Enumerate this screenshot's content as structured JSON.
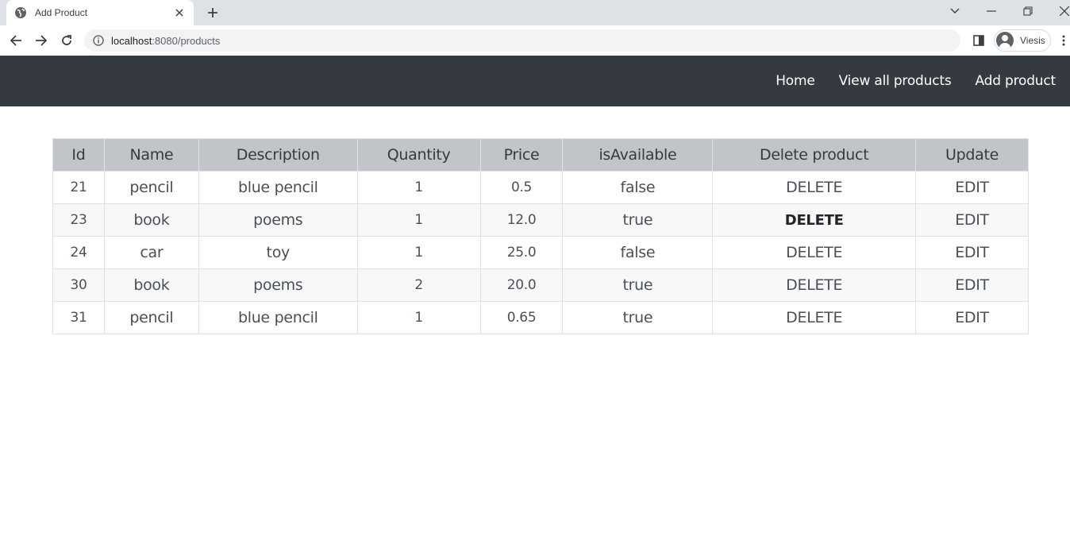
{
  "browser": {
    "tab_title": "Add Product",
    "url_host": "localhost",
    "url_path": ":8080/products",
    "profile_name": "Viesis"
  },
  "nav": {
    "links": [
      {
        "label": "Home"
      },
      {
        "label": "View all products"
      },
      {
        "label": "Add product"
      }
    ]
  },
  "table": {
    "headers": [
      "Id",
      "Name",
      "Description",
      "Quantity",
      "Price",
      "isAvailable",
      "Delete product",
      "Update"
    ],
    "rows": [
      {
        "id": "21",
        "name": "pencil",
        "description": "blue pencil",
        "quantity": "1",
        "price": "0.5",
        "available": "false",
        "delete": "DELETE",
        "edit": "EDIT"
      },
      {
        "id": "23",
        "name": "book",
        "description": "poems",
        "quantity": "1",
        "price": "12.0",
        "available": "true",
        "delete": "DELETE",
        "edit": "EDIT"
      },
      {
        "id": "24",
        "name": "car",
        "description": "toy",
        "quantity": "1",
        "price": "25.0",
        "available": "false",
        "delete": "DELETE",
        "edit": "EDIT"
      },
      {
        "id": "30",
        "name": "book",
        "description": "poems",
        "quantity": "2",
        "price": "20.0",
        "available": "true",
        "delete": "DELETE",
        "edit": "EDIT"
      },
      {
        "id": "31",
        "name": "pencil",
        "description": "blue pencil",
        "quantity": "1",
        "price": "0.65",
        "available": "true",
        "delete": "DELETE",
        "edit": "EDIT"
      }
    ]
  },
  "colors": {
    "navbar_bg": "#343a40",
    "header_bg": "#c1c5c9"
  }
}
